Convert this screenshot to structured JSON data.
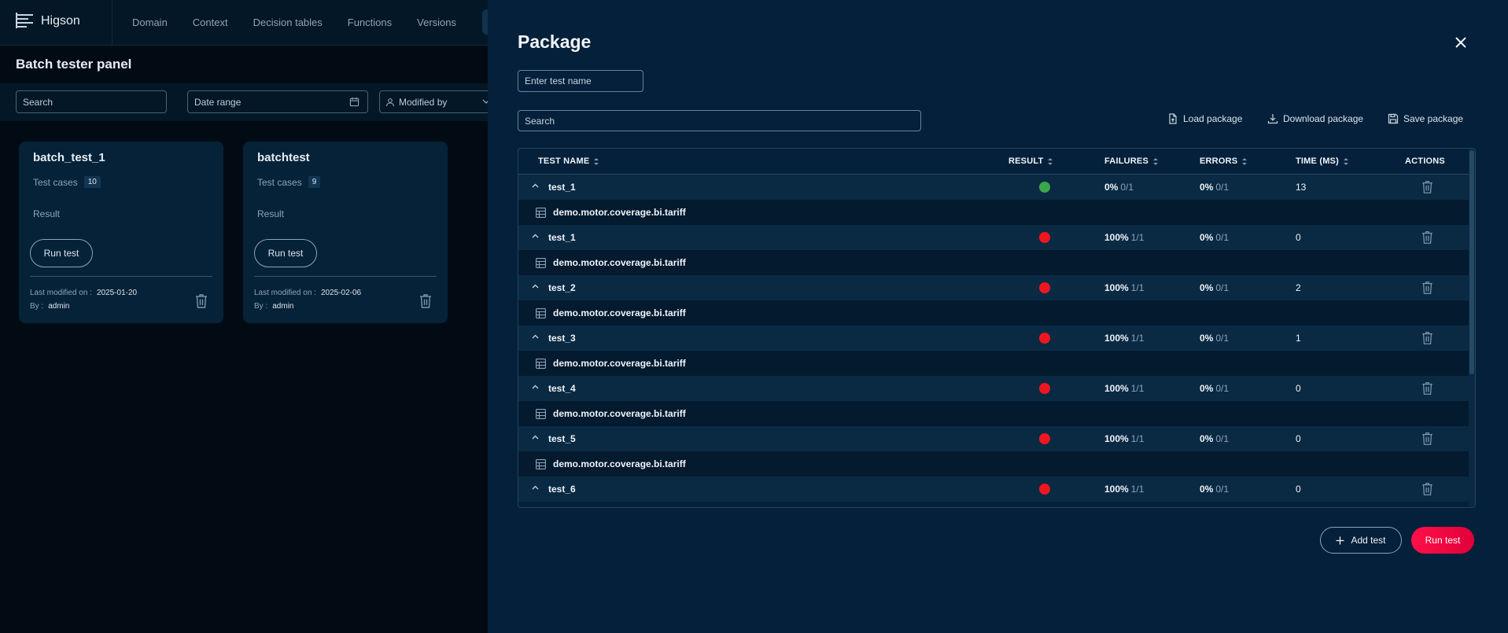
{
  "app": {
    "name": "Higson"
  },
  "nav": {
    "items": [
      "Domain",
      "Context",
      "Decision tables",
      "Functions",
      "Versions"
    ]
  },
  "panel": {
    "title": "Batch tester panel",
    "search_placeholder": "Search",
    "date_range_label": "Date range",
    "modified_by_label": "Modified by"
  },
  "cards": [
    {
      "title": "batch_test_1",
      "test_cases_label": "Test cases",
      "test_cases": "10",
      "result_label": "Result",
      "run_label": "Run test",
      "last_modified_label": "Last modified on :",
      "last_modified": "2025-01-20",
      "by_label": "By :",
      "by": "admin"
    },
    {
      "title": "batchtest",
      "test_cases_label": "Test cases",
      "test_cases": "9",
      "result_label": "Result",
      "run_label": "Run test",
      "last_modified_label": "Last modified on :",
      "last_modified": "2025-02-06",
      "by_label": "By :",
      "by": "admin"
    }
  ],
  "drawer": {
    "title": "Package",
    "test_name_placeholder": "Enter test name",
    "search_placeholder": "Search",
    "load_package": "Load package",
    "download_package": "Download package",
    "save_package": "Save package",
    "add_test": "Add test",
    "run_test": "Run test"
  },
  "table": {
    "headers": {
      "name": "TEST NAME",
      "result": "RESULT",
      "failures": "FAILURES",
      "errors": "ERRORS",
      "time": "TIME (MS)",
      "actions": "ACTIONS"
    },
    "rows": [
      {
        "name": "test_1",
        "status": "pass",
        "failures_pct": "0%",
        "failures_frac": "0/1",
        "errors_pct": "0%",
        "errors_frac": "0/1",
        "time": "13",
        "table": "demo.motor.coverage.bi.tariff"
      },
      {
        "name": "test_1",
        "status": "fail",
        "failures_pct": "100%",
        "failures_frac": "1/1",
        "errors_pct": "0%",
        "errors_frac": "0/1",
        "time": "0",
        "table": "demo.motor.coverage.bi.tariff"
      },
      {
        "name": "test_2",
        "status": "fail",
        "failures_pct": "100%",
        "failures_frac": "1/1",
        "errors_pct": "0%",
        "errors_frac": "0/1",
        "time": "2",
        "table": "demo.motor.coverage.bi.tariff"
      },
      {
        "name": "test_3",
        "status": "fail",
        "failures_pct": "100%",
        "failures_frac": "1/1",
        "errors_pct": "0%",
        "errors_frac": "0/1",
        "time": "1",
        "table": "demo.motor.coverage.bi.tariff"
      },
      {
        "name": "test_4",
        "status": "fail",
        "failures_pct": "100%",
        "failures_frac": "1/1",
        "errors_pct": "0%",
        "errors_frac": "0/1",
        "time": "0",
        "table": "demo.motor.coverage.bi.tariff"
      },
      {
        "name": "test_5",
        "status": "fail",
        "failures_pct": "100%",
        "failures_frac": "1/1",
        "errors_pct": "0%",
        "errors_frac": "0/1",
        "time": "0",
        "table": "demo.motor.coverage.bi.tariff"
      },
      {
        "name": "test_6",
        "status": "fail",
        "failures_pct": "100%",
        "failures_frac": "1/1",
        "errors_pct": "0%",
        "errors_frac": "0/1",
        "time": "0",
        "table": null
      }
    ]
  },
  "colors": {
    "pass": "#3aa84a",
    "fail": "#f01620",
    "accent": "#ff1048"
  }
}
